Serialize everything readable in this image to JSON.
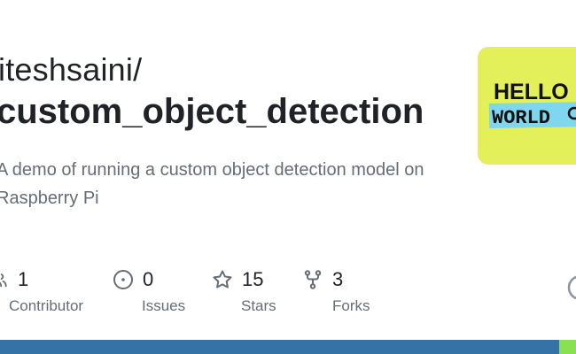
{
  "repo": {
    "owner": "iteshsaini/",
    "name": "custom_object_detection",
    "description": "A demo of running a custom object detection model on Raspberry Pi"
  },
  "avatar": {
    "line1": "HELLO",
    "line2": "WORLD"
  },
  "stats": {
    "contributors": {
      "count": "1",
      "label": "Contributor",
      "icon": "people-icon"
    },
    "issues": {
      "count": "0",
      "label": "Issues",
      "icon": "issue-opened-icon"
    },
    "stars": {
      "count": "15",
      "label": "Stars",
      "icon": "star-icon"
    },
    "forks": {
      "count": "3",
      "label": "Forks",
      "icon": "repo-forked-icon"
    }
  },
  "colors": {
    "primary_language": "#3572a5",
    "secondary_language": "#89e051",
    "avatar_bg": "#e4f05a"
  }
}
